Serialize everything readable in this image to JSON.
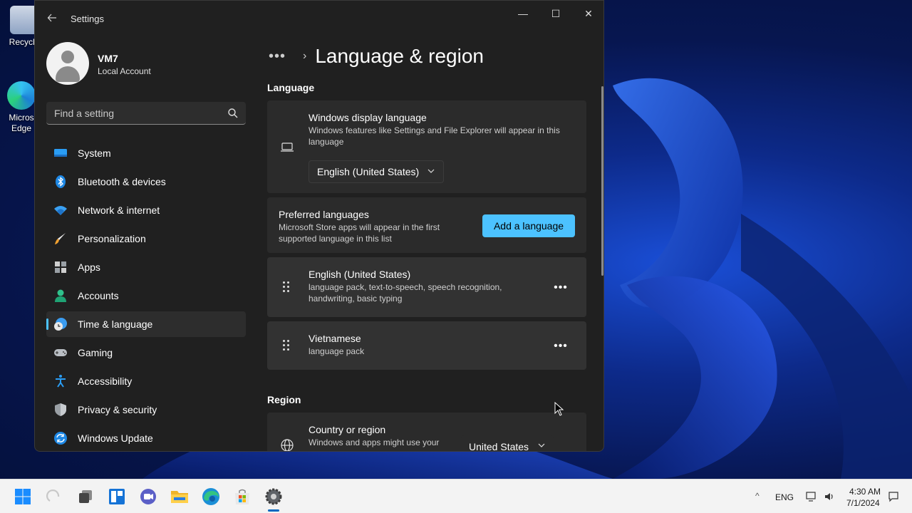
{
  "desktop": {
    "icons": [
      {
        "label": "Recycle"
      },
      {
        "label": "Micros Edge"
      }
    ]
  },
  "window": {
    "title": "Settings",
    "controls": {
      "minimize": "—",
      "maximize": "☐",
      "close": "✕"
    }
  },
  "profile": {
    "name": "VM7",
    "account_type": "Local Account"
  },
  "search": {
    "placeholder": "Find a setting"
  },
  "sidebar": {
    "items": [
      {
        "label": "System",
        "icon": "system-icon"
      },
      {
        "label": "Bluetooth & devices",
        "icon": "bluetooth-icon"
      },
      {
        "label": "Network & internet",
        "icon": "wifi-icon"
      },
      {
        "label": "Personalization",
        "icon": "brush-icon"
      },
      {
        "label": "Apps",
        "icon": "apps-icon"
      },
      {
        "label": "Accounts",
        "icon": "accounts-icon"
      },
      {
        "label": "Time & language",
        "icon": "clock-globe-icon",
        "selected": true
      },
      {
        "label": "Gaming",
        "icon": "gamepad-icon"
      },
      {
        "label": "Accessibility",
        "icon": "accessibility-icon"
      },
      {
        "label": "Privacy & security",
        "icon": "shield-icon"
      },
      {
        "label": "Windows Update",
        "icon": "update-icon"
      }
    ]
  },
  "main": {
    "breadcrumb_more": "•••",
    "breadcrumb_sep": "›",
    "title": "Language & region",
    "language_section": {
      "heading": "Language",
      "display_language": {
        "title": "Windows display language",
        "description": "Windows features like Settings and File Explorer will appear in this language",
        "selected": "English (United States)"
      },
      "preferred": {
        "title": "Preferred languages",
        "description": "Microsoft Store apps will appear in the first supported language in this list",
        "button": "Add a language"
      },
      "languages": [
        {
          "name": "English (United States)",
          "features": "language pack, text-to-speech, speech recognition, handwriting, basic typing"
        },
        {
          "name": "Vietnamese",
          "features": "language pack"
        }
      ],
      "more_label": "•••"
    },
    "region_section": {
      "heading": "Region",
      "country": {
        "title": "Country or region",
        "description": "Windows and apps might use your",
        "selected": "United States"
      }
    }
  },
  "taskbar": {
    "apps": [
      "start-icon",
      "search-icon",
      "task-view-icon",
      "widgets-icon",
      "chat-icon",
      "file-explorer-icon",
      "edge-icon",
      "store-icon",
      "settings-icon"
    ],
    "tray": {
      "language": "ENG",
      "time": "4:30 AM",
      "date": "7/1/2024"
    }
  },
  "colors": {
    "accent": "#4cc2ff",
    "window_bg": "#202020",
    "card_bg": "#2b2b2b"
  }
}
